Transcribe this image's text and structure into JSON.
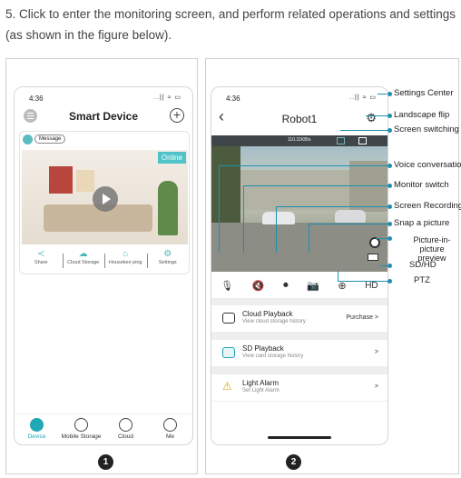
{
  "intro_text": "5. Click to enter the monitoring screen, and perform related operations and settings (as shown in the figure below).",
  "phone1": {
    "time": "4:36",
    "signal": "..|| ≈ ▭",
    "title": "Smart Device",
    "message_badge": "Message",
    "online": "Online",
    "actions": [
      {
        "label": "Share",
        "icon": "share-icon"
      },
      {
        "label": "Cloud Storage",
        "icon": "cloud-icon"
      },
      {
        "label": "Housekee ping",
        "icon": "home-icon"
      },
      {
        "label": "Settings",
        "icon": "gear-icon"
      }
    ],
    "tabs": [
      {
        "label": "Device",
        "icon": "device-icon",
        "active": true
      },
      {
        "label": "Mobile Storage",
        "icon": "storage-icon"
      },
      {
        "label": "Cloud",
        "icon": "cloud-icon"
      },
      {
        "label": "Me",
        "icon": "person-icon"
      }
    ]
  },
  "phone2": {
    "time": "4:36",
    "signal": "..|| ≈ ▭",
    "title": "Robot1",
    "rate": "110.31KB/s",
    "hd_label": "HD",
    "rows": [
      {
        "title": "Cloud Playback",
        "subtitle": "View cloud storage history",
        "right": "Purchase >"
      },
      {
        "title": "SD Playback",
        "subtitle": "View card storage history",
        "right": ">"
      },
      {
        "title": "Light Alarm",
        "subtitle": "Set Light Alarm",
        "right": ">"
      }
    ]
  },
  "callouts": {
    "settings": "Settings Center",
    "landscape": "Landscape flip",
    "screen_switch": "Screen switching",
    "voice": "Voice conversation",
    "monitor": "Monitor switch",
    "recording": "Screen Recording",
    "snap": "Snap a picture",
    "pip": "Picture-in-picture preview",
    "sdhd": "SD/HD",
    "ptz": "PTZ"
  },
  "numbers": [
    "1",
    "2"
  ]
}
